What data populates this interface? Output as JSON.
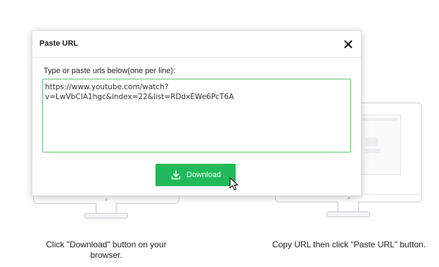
{
  "dialog": {
    "title": "Paste URL",
    "close_icon": "close-icon",
    "prompt_label": "Type or paste urls below(one per line):",
    "url_value": "https://www.youtube.com/watch?v=LwVbCIA1hgc&index=22&list=RDdxEWe6PcT6A",
    "download_label": "Download",
    "download_icon": "download-icon",
    "accent_color": "#22b95a"
  },
  "captions": {
    "left": "Click \"Download\" button on your browser.",
    "right": "Copy URL then click \"Paste URL\" button."
  }
}
